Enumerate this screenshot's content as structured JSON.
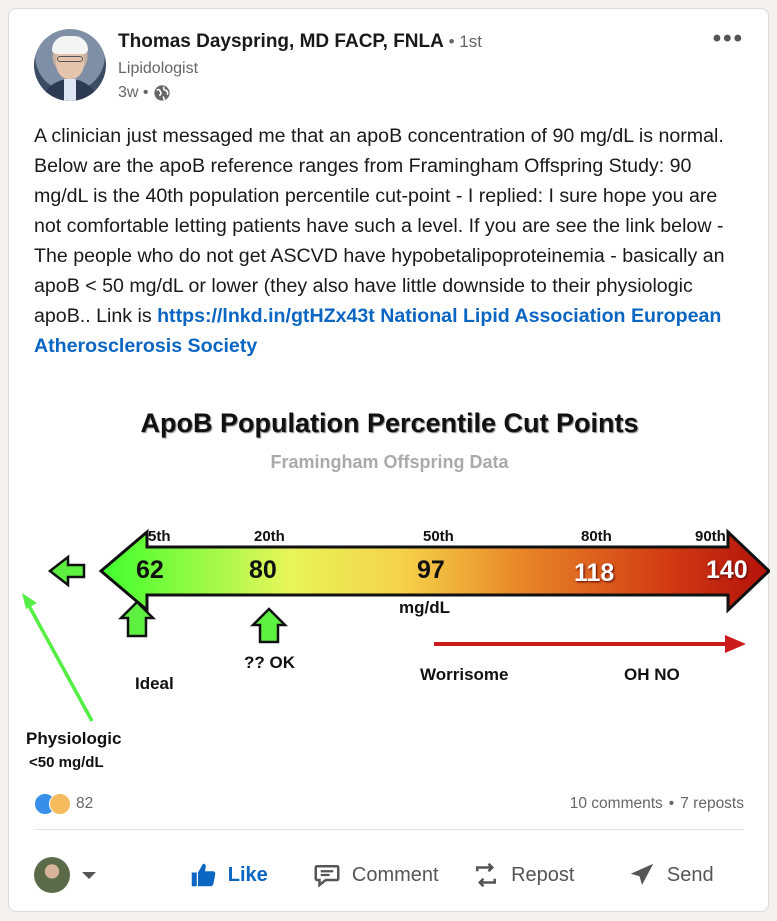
{
  "post": {
    "author_name": "Thomas Dayspring, MD FACP, FNLA",
    "degree": " • 1st",
    "headline": "Lipidologist",
    "time": "3w •",
    "text_before_link": "A clinician just messaged me that an apoB concentration of 90 mg/dL is normal. Below are the apoB reference ranges from Framingham Offspring Study: 90 mg/dL is the 40th population percentile cut-point - I replied: I sure hope you are not comfortable letting patients have such a level. If you are see the link below - The people who do not get ASCVD have hypobetalipoproteinemia - basically an apoB < 50 mg/dL or lower (they also have little downside to their physiologic apoB.. Link is ",
    "link_text": "https://lnkd.in/gtHZx43t National Lipid Association European Atherosclerosis Society"
  },
  "chart_data": {
    "type": "bar",
    "title": "ApoB Population Percentile Cut Points",
    "subtitle": "Framingham Offspring Data",
    "unit": "mg/dL",
    "categories": [
      "5th",
      "20th",
      "50th",
      "80th",
      "90th"
    ],
    "values": [
      62,
      80,
      97,
      118,
      140
    ],
    "annotations": {
      "ideal": "Ideal",
      "ok": "?? OK",
      "worrisome": "Worrisome",
      "ohno": "OH NO",
      "physiologic": "Physiologic",
      "physiologic_sub": "<50 mg/dL"
    },
    "colors": {
      "low": "#52ff3a",
      "mid": "#f7e85c",
      "high": "#c81e0e",
      "arrow_green": "#55ee44",
      "arrow_red": "#cc1b1b"
    }
  },
  "social": {
    "reactions_count": "82",
    "comments": "10 comments",
    "separator": "•",
    "reposts": "7 reposts"
  },
  "actions": {
    "like": "Like",
    "comment": "Comment",
    "repost": "Repost",
    "send": "Send"
  }
}
